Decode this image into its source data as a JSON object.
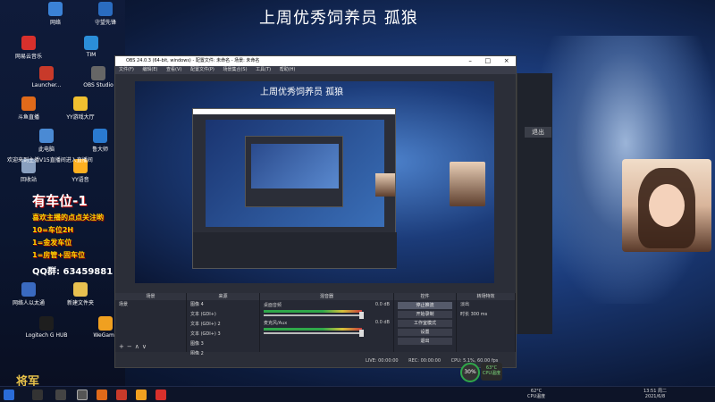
{
  "banner_title": "上周优秀饲养员 孤狼",
  "desktop_icons": [
    {
      "label": "网络",
      "color": "#3b82d6"
    },
    {
      "label": "守望先锋",
      "color": "#2a6cc0"
    },
    {
      "label": "网易云音乐",
      "color": "#d8302c"
    },
    {
      "label": "TIM",
      "color": "#2b8ed8"
    },
    {
      "label": "Launcher...",
      "color": "#c83a2a"
    },
    {
      "label": "OBS Studio",
      "color": "#666"
    },
    {
      "label": "斗鱼直播",
      "color": "#e06a1a"
    },
    {
      "label": "YY游戏大厅",
      "color": "#f0c030"
    },
    {
      "label": "此电脑",
      "color": "#4a8ad4"
    },
    {
      "label": "鲁大师",
      "color": "#2a7ad0"
    },
    {
      "label": "回收站",
      "color": "#8aa0c0"
    },
    {
      "label": "YY语音",
      "color": "#ffb020"
    },
    {
      "label": "网络人以太通",
      "color": "#3a6ac0"
    },
    {
      "label": "新建文件夹",
      "color": "#e8c050"
    },
    {
      "label": "Logitech G HUB",
      "color": "#1e1e1e"
    },
    {
      "label": "WeGame",
      "color": "#f0a020"
    }
  ],
  "welcome_text": "欢迎来到主播V15直播间进入直播间",
  "promo": {
    "title": "有车位-1",
    "subtitle": "喜欢主播的点点关注哟",
    "lines": [
      "10=车位2H",
      "1=金发车位",
      "1=房管+固车位"
    ],
    "qq_label": "QQ群:",
    "qq": "63459881"
  },
  "logo_text": "将军",
  "obs": {
    "title": "OBS 24.0.3 (64-bit, windows) - 配置文件: 未命名 - 场景: 未命名",
    "menu": [
      "文件(F)",
      "编辑(E)",
      "查看(V)",
      "配置文件(P)",
      "场景集合(S)",
      "工具(T)",
      "帮助(H)"
    ],
    "preview_title": "上周优秀饲养员 孤狼",
    "panels": {
      "scenes": {
        "title": "场景",
        "items": [
          "场景"
        ]
      },
      "sources": {
        "title": "来源",
        "items": [
          "图像 4",
          "文本 (GDI+)",
          "文本 (GDI+) 2",
          "文本 (GDI+) 3",
          "图像 3",
          "图像 2"
        ]
      },
      "mixer": {
        "title": "混音器",
        "rows": [
          {
            "label": "桌面音频",
            "db": "0.0 dB"
          },
          {
            "label": "麦克风/Aux",
            "db": "0.0 dB"
          }
        ]
      },
      "controls": {
        "title": "控件",
        "buttons": [
          "停止推流",
          "开始录制",
          "工作室模式",
          "设置",
          "退出"
        ]
      },
      "transitions": {
        "title": "转场特效",
        "type": "淡出",
        "duration_label": "时长",
        "duration": "300 ms"
      }
    },
    "status": {
      "live": "LIVE: 00:00:00",
      "rec": "REC: 00:00:00",
      "cpu": "CPU: 5.1%, 60.00 fps"
    }
  },
  "side_window": {
    "exit_label": "退出"
  },
  "fps_badge": "30%",
  "cpu_badge": {
    "temp": "63°C",
    "label": "CPU温度"
  },
  "taskbar": {
    "weather_temp": "62°C",
    "weather_label": "CPU温度",
    "time": "13:51 周二",
    "date": "2021/6/8"
  }
}
